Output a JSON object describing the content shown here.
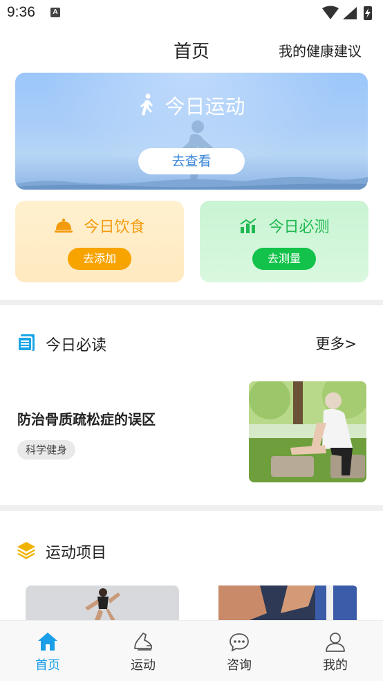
{
  "status_bar": {
    "time": "9:36",
    "notification_badge": "A"
  },
  "header": {
    "title": "首页",
    "right_link": "我的健康建议"
  },
  "exercise_banner": {
    "title": "今日运动",
    "button_label": "去查看",
    "icon": "running-person-icon"
  },
  "diet_card": {
    "title": "今日饮食",
    "button_label": "去添加",
    "icon": "food-cloche-icon",
    "accent_color": "#f7a300"
  },
  "test_card": {
    "title": "今日必测",
    "button_label": "去测量",
    "icon": "bar-chart-icon",
    "accent_color": "#12c24a"
  },
  "reading_section": {
    "title": "今日必读",
    "more_label": "更多>",
    "icon": "document-list-icon",
    "article": {
      "title": "防治骨质疏松症的误区",
      "tag": "科学健身",
      "image": "elderly-man-stretching-park-photo"
    }
  },
  "sports_section": {
    "title": "运动项目",
    "icon": "layers-stack-icon",
    "items": [
      {
        "image": "woman-running-photo"
      },
      {
        "image": "hands-stretching-photo"
      }
    ]
  },
  "bottom_nav": {
    "active_color": "#1a9ee8",
    "items": [
      {
        "label": "首页",
        "icon": "home-icon",
        "active": true
      },
      {
        "label": "运动",
        "icon": "sneaker-icon",
        "active": false
      },
      {
        "label": "咨询",
        "icon": "chat-bubble-icon",
        "active": false
      },
      {
        "label": "我的",
        "icon": "user-icon",
        "active": false
      }
    ]
  }
}
